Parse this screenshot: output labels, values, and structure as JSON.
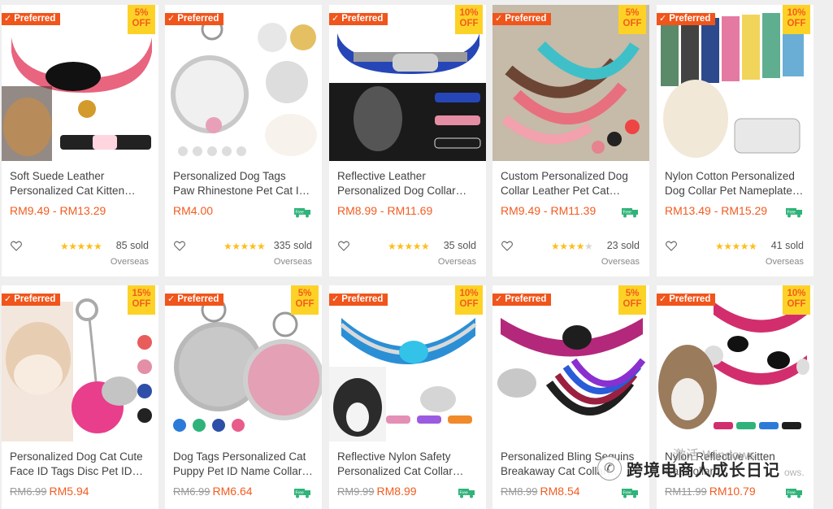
{
  "badges": {
    "preferred": "Preferred"
  },
  "products": [
    {
      "title1": "Soft Suede Leather",
      "title2": "Personalized Cat Kitten…",
      "price_from": "RM9.49",
      "price_to": "RM13.29",
      "discount": "5%",
      "off": "OFF",
      "rating": 5,
      "sold": "85 sold",
      "location": "Overseas",
      "free_shipping": false,
      "colors": [
        "#e8647f",
        "#ffd5e0",
        "#3a2a20"
      ]
    },
    {
      "title1": "Personalized Dog Tags",
      "title2": "Paw Rhinestone Pet Cat I…",
      "price": "RM4.00",
      "discount": "",
      "rating": 5,
      "sold": "335 sold",
      "location": "Overseas",
      "free_shipping": true,
      "colors": [
        "#c9c9c9",
        "#f0f0f0",
        "#e8a0b8"
      ]
    },
    {
      "title1": "Reflective Leather",
      "title2": "Personalized Dog Collar…",
      "price_from": "RM8.99",
      "price_to": "RM11.69",
      "discount": "10%",
      "off": "OFF",
      "rating": 5,
      "sold": "35 sold",
      "location": "Overseas",
      "free_shipping": false,
      "colors": [
        "#2646b8",
        "#1a1a1a",
        "#d0d0d0"
      ]
    },
    {
      "title1": "Custom Personalized Dog",
      "title2": "Collar Leather Pet Cat…",
      "price_from": "RM9.49",
      "price_to": "RM11.39",
      "discount": "5%",
      "off": "OFF",
      "rating": 4,
      "sold": "23 sold",
      "location": "Overseas",
      "free_shipping": true,
      "colors": [
        "#b4a48f",
        "#e86f7e",
        "#3fc0c8"
      ]
    },
    {
      "title1": "Nylon Cotton Personalized",
      "title2": "Dog Collar Pet Nameplate…",
      "price_from": "RM13.49",
      "price_to": "RM15.29",
      "discount": "10%",
      "off": "OFF",
      "rating": 5,
      "sold": "41 sold",
      "location": "Overseas",
      "free_shipping": true,
      "colors": [
        "#f4f4f4",
        "#5fae90",
        "#6aaed6"
      ]
    },
    {
      "title1": "Personalized Dog Cat Cute",
      "title2": "Face ID Tags Disc Pet ID…",
      "old_price": "RM6.99",
      "price": "RM5.94",
      "discount": "15%",
      "off": "OFF",
      "free_shipping": false,
      "colors": [
        "#f3e6dc",
        "#e83e8c",
        "#c4c4c4"
      ]
    },
    {
      "title1": "Dog Tags Personalized Cat",
      "title2": "Puppy Pet ID Name Collar…",
      "old_price": "RM6.99",
      "price": "RM6.64",
      "discount": "5%",
      "off": "OFF",
      "free_shipping": true,
      "colors": [
        "#b9b9b9",
        "#e4a0b4",
        "#ffffff"
      ]
    },
    {
      "title1": "Reflective Nylon Safety",
      "title2": "Personalized Cat Collar…",
      "old_price": "RM9.99",
      "price": "RM8.99",
      "discount": "10%",
      "off": "OFF",
      "free_shipping": true,
      "colors": [
        "#2b8fd6",
        "#33c3e8",
        "#d9d9d9"
      ]
    },
    {
      "title1": "Personalized Bling Sequins",
      "title2": "Breakaway Cat Collar…",
      "old_price": "RM8.99",
      "price": "RM8.54",
      "discount": "5%",
      "off": "OFF",
      "free_shipping": true,
      "colors": [
        "#b3287a",
        "#1e1e1e",
        "#c8c8c8"
      ]
    },
    {
      "title1": "Nylon Reflective Kitten",
      "title2": "Cat Collar…",
      "old_price": "RM11.99",
      "price": "RM10.79",
      "discount": "10%",
      "off": "OFF",
      "free_shipping": true,
      "colors": [
        "#d22e6e",
        "#f1ede8",
        "#9a7b5c"
      ]
    }
  ],
  "watermark": {
    "text": "跨境电商人成长日记",
    "activate": "激活 Windows",
    "activate2": "ows."
  },
  "colors": {
    "accent": "#f25c20",
    "preferred_bg": "#f0551c",
    "off_bg": "#fdd226",
    "star": "#fbbf1f",
    "free": "#2fb37a"
  }
}
